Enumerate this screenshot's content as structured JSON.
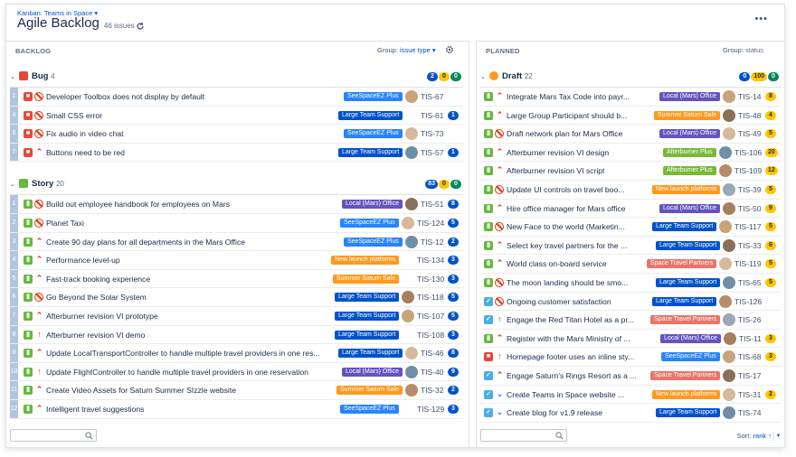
{
  "header": {
    "breadcrumb": "Kanban: Teams in Space ▾",
    "title": "Agile Backlog",
    "issue_count": "46 issues",
    "more": "•••"
  },
  "colors": {
    "label_purple": "#6554c0",
    "label_blue": "#2684ff",
    "label_navy": "#0052cc",
    "label_orange": "#ff991f",
    "label_green": "#79b939",
    "label_red": "#e8756a"
  },
  "backlog": {
    "title": "BACKLOG",
    "group_label": "Group:",
    "group_value": "issue type ▾",
    "search_placeholder": "",
    "groups": [
      {
        "name": "Bug",
        "count": "4",
        "icon": "bug",
        "badges": [
          "2",
          "0",
          "0"
        ],
        "rows": [
          {
            "rank": "1",
            "type": "bug",
            "prio": "blocker",
            "summary": "Developer Toolbox does not display by default",
            "label": "SeeSpaceEZ Plus",
            "lc": "#2684ff",
            "avatar": true,
            "key": "TIS-67",
            "est": ""
          },
          {
            "rank": "4",
            "type": "bug",
            "prio": "blocker",
            "summary": "Small CSS error",
            "label": "Large Team Support",
            "lc": "#0052cc",
            "avatar": false,
            "key": "TIS-61",
            "est": "1"
          },
          {
            "rank": "6",
            "type": "bug",
            "prio": "blocker",
            "summary": "Fix audio in video chat",
            "label": "SeeSpaceEZ Plus",
            "lc": "#2684ff",
            "avatar": true,
            "key": "TIS-73",
            "est": ""
          },
          {
            "rank": "7",
            "type": "bug",
            "prio": "highest",
            "summary": "Buttons need to be red",
            "label": "Large Team Support",
            "lc": "#0052cc",
            "avatar": true,
            "key": "TIS-57",
            "est": "1"
          }
        ]
      },
      {
        "name": "Story",
        "count": "20",
        "icon": "story",
        "badges": [
          "83",
          "0",
          "0"
        ],
        "rows": [
          {
            "rank": "1",
            "type": "story",
            "prio": "blocker",
            "summary": "Build out employee handbook for employees on Mars",
            "label": "Local (Mars) Office",
            "lc": "#6554c0",
            "avatar": true,
            "key": "TIS-51",
            "est": "8"
          },
          {
            "rank": "2",
            "type": "story",
            "prio": "blocker",
            "summary": "Planet Taxi",
            "label": "SeeSpaceEZ Plus",
            "lc": "#2684ff",
            "avatar": true,
            "key": "TIS-124",
            "est": "5"
          },
          {
            "rank": "3",
            "type": "story",
            "prio": "highest",
            "summary": "Create 90 day plans for all departments in the Mars Office",
            "label": "SeeSpaceEZ Plus",
            "lc": "#2684ff",
            "avatar": true,
            "key": "TIS-12",
            "est": "2"
          },
          {
            "rank": "4",
            "type": "story",
            "prio": "highest",
            "summary": "Performance level-up",
            "label": "New launch platforms",
            "lc": "#ff991f",
            "avatar": false,
            "key": "TIS-134",
            "est": "3"
          },
          {
            "rank": "5",
            "type": "story",
            "prio": "highest",
            "summary": "Fast-track booking experience",
            "label": "Summer Saturn Sale",
            "lc": "#ff991f",
            "avatar": false,
            "key": "TIS-130",
            "est": "3"
          },
          {
            "rank": "6",
            "type": "story",
            "prio": "blocker",
            "summary": "Go Beyond the Solar System",
            "label": "Large Team Support",
            "lc": "#0052cc",
            "avatar": true,
            "key": "TIS-118",
            "est": "5"
          },
          {
            "rank": "7",
            "type": "story",
            "prio": "highest",
            "summary": "Afterburner revision VI prototype",
            "label": "Large Team Support",
            "lc": "#0052cc",
            "avatar": true,
            "key": "TIS-107",
            "est": "5"
          },
          {
            "rank": "8",
            "type": "story",
            "prio": "high",
            "summary": "Afterburner revision VI demo",
            "label": "Large Team Support",
            "lc": "#0052cc",
            "avatar": false,
            "key": "TIS-108",
            "est": "3"
          },
          {
            "rank": "9",
            "type": "story",
            "prio": "highest",
            "summary": "Update LocalTransportController to handle multiple travel providers in one res...",
            "label": "Large Team Support",
            "lc": "#0052cc",
            "avatar": true,
            "key": "TIS-46",
            "est": "8"
          },
          {
            "rank": "10",
            "type": "story",
            "prio": "high",
            "summary": "Update FlightController to handle multiple travel providers in one reservation",
            "label": "Local (Mars) Office",
            "lc": "#6554c0",
            "avatar": true,
            "key": "TIS-40",
            "est": "9"
          },
          {
            "rank": "11",
            "type": "story",
            "prio": "highest",
            "summary": "Create Video Assets for Saturn Summer SIzzle website",
            "label": "Summer Saturn Sale",
            "lc": "#ff991f",
            "avatar": true,
            "key": "TIS-32",
            "est": "2"
          },
          {
            "rank": "12",
            "type": "story",
            "prio": "highest",
            "summary": "Intelligent travel suggestions",
            "label": "SeeSpaceEZ Plus",
            "lc": "#2684ff",
            "avatar": false,
            "key": "TIS-129",
            "est": "3"
          }
        ]
      }
    ]
  },
  "planned": {
    "title": "PLANNED",
    "group_label": "Group:",
    "group_value": "status",
    "sort_label": "Sort:",
    "sort_value": "rank ↑",
    "group": {
      "name": "Draft",
      "count": "22",
      "badges": [
        "0",
        "100",
        "0"
      ],
      "rows": [
        {
          "type": "story",
          "prio": "highest",
          "summary": "Integrate Mars Tax Code into payr...",
          "label": "Local (Mars) Office",
          "lc": "#6554c0",
          "key": "TIS-14",
          "est": "8"
        },
        {
          "type": "story",
          "prio": "highest",
          "summary": "Large Group Participant should b...",
          "label": "Summer Saturn Sale",
          "lc": "#ff991f",
          "key": "TIS-48",
          "est": "4"
        },
        {
          "type": "story",
          "prio": "blocker",
          "summary": "Draft network plan for Mars Office",
          "label": "Local (Mars) Office",
          "lc": "#6554c0",
          "key": "TIS-49",
          "est": "5"
        },
        {
          "type": "story",
          "prio": "highest",
          "summary": "Afterburner revision VI design",
          "label": "Afterburner Plus",
          "lc": "#79b939",
          "key": "TIS-106",
          "est": "20"
        },
        {
          "type": "story",
          "prio": "highest",
          "summary": "Afterburner revision VI script",
          "label": "Afterburner Plus",
          "lc": "#79b939",
          "key": "TIS-109",
          "est": "12"
        },
        {
          "type": "story",
          "prio": "blocker",
          "summary": "Update UI controls on travel boo...",
          "label": "New launch platforms",
          "lc": "#ff991f",
          "key": "TIS-39",
          "est": "5"
        },
        {
          "type": "story",
          "prio": "highest",
          "summary": "Hire office manager for Mars office",
          "label": "Local (Mars) Office",
          "lc": "#6554c0",
          "key": "TIS-50",
          "est": "9"
        },
        {
          "type": "story",
          "prio": "blocker",
          "summary": "New Face to the world (Marketin...",
          "label": "Large Team Support",
          "lc": "#0052cc",
          "key": "TIS-117",
          "est": "5"
        },
        {
          "type": "story",
          "prio": "highest",
          "summary": "Select key travel partners for the ...",
          "label": "Large Team Support",
          "lc": "#0052cc",
          "key": "TIS-33",
          "est": "6"
        },
        {
          "type": "story",
          "prio": "highest",
          "summary": "World class on-board service",
          "label": "Space Travel Partners",
          "lc": "#e8756a",
          "key": "TIS-119",
          "est": "5"
        },
        {
          "type": "story",
          "prio": "blocker",
          "summary": "The moon landing should be smo...",
          "label": "Large Team Support",
          "lc": "#0052cc",
          "key": "TIS-65",
          "est": "5"
        },
        {
          "type": "task",
          "prio": "blocker",
          "summary": "Ongoing customer satisfaction",
          "label": "Large Team Support",
          "lc": "#0052cc",
          "key": "TIS-126",
          "est": ""
        },
        {
          "type": "task",
          "prio": "high",
          "summary": "Engage the Red Titan Hotel as a pr...",
          "label": "Space Travel Partners",
          "lc": "#e8756a",
          "key": "TIS-26",
          "est": ""
        },
        {
          "type": "story",
          "prio": "highest",
          "summary": "Register with the Mars Ministry of ...",
          "label": "Local (Mars) Office",
          "lc": "#6554c0",
          "key": "TIS-11",
          "est": "3"
        },
        {
          "type": "bug",
          "prio": "high",
          "summary": "Homepage footer uses an inline sty...",
          "label": "SeeSpaceEZ Plus",
          "lc": "#2684ff",
          "key": "TIS-68",
          "est": "3"
        },
        {
          "type": "task",
          "prio": "highest",
          "summary": "Engage Saturn's Rings Resort as a ...",
          "label": "Space Travel Partners",
          "lc": "#e8756a",
          "key": "TIS-17",
          "est": ""
        },
        {
          "type": "task",
          "prio": "low",
          "summary": "Create Teams in Space website ...",
          "label": "New launch platforms",
          "lc": "#ff991f",
          "key": "TIS-31",
          "est": "2"
        },
        {
          "type": "task",
          "prio": "low",
          "summary": "Create blog for v1.9 release",
          "label": "Large Team Support",
          "lc": "#0052cc",
          "key": "TIS-74",
          "est": ""
        }
      ]
    }
  }
}
